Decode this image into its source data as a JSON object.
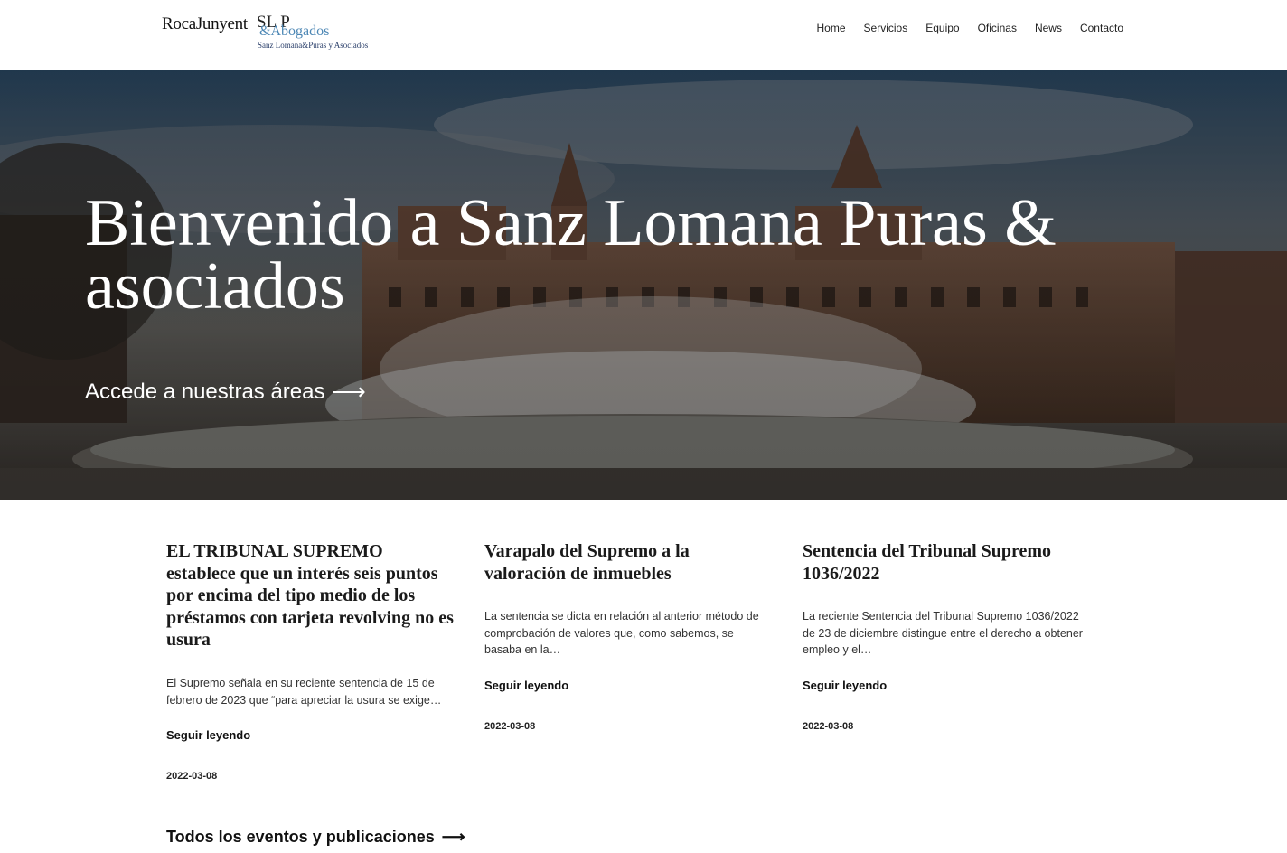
{
  "header": {
    "logo": {
      "brand1": "RocaJunyent",
      "brand2": "SL P",
      "brand3": "&Abogados",
      "tagline": "Sanz Lomana&Puras y Asociados"
    },
    "nav": [
      "Home",
      "Servicios",
      "Equipo",
      "Oficinas",
      "News",
      "Contacto"
    ]
  },
  "hero": {
    "title": "Bienvenido a Sanz Lomana Puras & asociados",
    "cta": "Accede a nuestras áreas",
    "cta_arrow": "⟶"
  },
  "posts": [
    {
      "title": "EL TRIBUNAL SUPREMO establece que un interés seis puntos por encima del tipo medio de los préstamos con tarjeta revolving no es usura",
      "excerpt": "El Supremo señala en su reciente sentencia de 15 de febrero de 2023 que “para apreciar la usura se exige…",
      "more": "Seguir leyendo",
      "date": "2022-03-08"
    },
    {
      "title": "Varapalo del Supremo a la valoración de inmuebles",
      "excerpt": "La sentencia se dicta en relación al anterior método de comprobación de valores que, como sabemos, se basaba en la…",
      "more": "Seguir leyendo",
      "date": "2022-03-08"
    },
    {
      "title": "Sentencia del Tribunal Supremo 1036/2022",
      "excerpt": "La reciente Sentencia del Tribunal Supremo 1036/2022 de 23 de diciembre distingue entre el derecho a obtener empleo y el…",
      "more": "Seguir leyendo",
      "date": "2022-03-08"
    }
  ],
  "footer_link": {
    "label": "Todos los eventos y publicaciones",
    "arrow": "⟶"
  }
}
